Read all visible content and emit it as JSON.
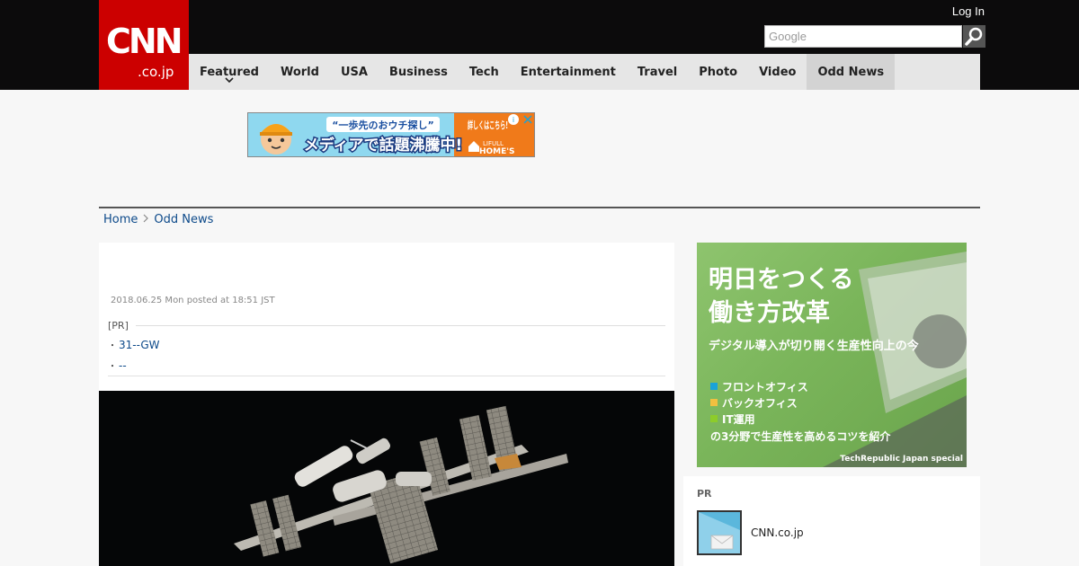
{
  "header": {
    "logo": {
      "main": "CNN",
      "sub": ".co.jp"
    },
    "login": "Log In",
    "search": {
      "placeholder": "Google"
    }
  },
  "nav": {
    "items": [
      {
        "label": "Featured",
        "has_dropdown": true
      },
      {
        "label": "World"
      },
      {
        "label": "USA"
      },
      {
        "label": "Business"
      },
      {
        "label": "Tech"
      },
      {
        "label": "Entertainment"
      },
      {
        "label": "Travel"
      },
      {
        "label": "Photo"
      },
      {
        "label": "Video"
      },
      {
        "label": "Odd News",
        "active": true
      }
    ]
  },
  "top_ad": {
    "line1": "“一歩先のおウチ探し”",
    "line2": "メディアで話題沸騰中!",
    "cta": "詳しくはこちら!",
    "brand_top": "LIFULL",
    "brand_bottom": "HOME'S"
  },
  "breadcrumb": [
    "Home",
    "Odd News"
  ],
  "article": {
    "date": "2018.06.25 Mon posted at 18:51 JST",
    "pr_label": "[PR]",
    "pr_links": [
      "31--GW",
      "--"
    ]
  },
  "side_ad": {
    "heading_line1": "明日をつくる",
    "heading_line2": "働き方改革",
    "subheading": "デジタル導入が切り開く生産性向上の今",
    "items": [
      {
        "label": "フロントオフィス",
        "color": "#1aa3d9"
      },
      {
        "label": "バックオフィス",
        "color": "#f0c040"
      },
      {
        "label": "IT運用",
        "color": "#8dcc2a"
      }
    ],
    "footer": "の3分野で生産性を高めるコツを紹介",
    "credit": "TechRepublic Japan special"
  },
  "pr_card": {
    "label": "PR",
    "title": "CNN.co.jp"
  },
  "colors": {
    "brand_red": "#cc0000",
    "header_bg": "#0c0b0c",
    "nav_bg": "#e6e6e6",
    "link": "#0d4a8a"
  }
}
